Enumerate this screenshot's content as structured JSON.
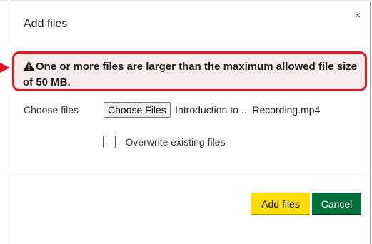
{
  "dialog": {
    "title": "Add files",
    "close_glyph": "×"
  },
  "error": {
    "icon": "warning-triangle-icon",
    "message": "One or more files are larger than the maximum allowed file size of 50 MB.",
    "border_color": "#e4171f",
    "background_color": "#f7ecec"
  },
  "annotation": {
    "arrow_color": "#e4171f"
  },
  "form": {
    "choose_files_label": "Choose files",
    "choose_button_label": "Choose Files",
    "selected_file": "Introduction to ... Recording.mp4",
    "overwrite_label": "Overwrite existing files",
    "overwrite_checked": false
  },
  "actions": {
    "add_label": "Add files",
    "add_color": "#ffdd00",
    "cancel_label": "Cancel",
    "cancel_color": "#00703c"
  }
}
